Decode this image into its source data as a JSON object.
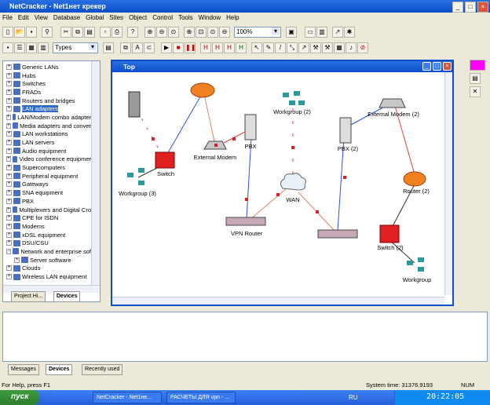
{
  "app": {
    "title": "NetCracker - Net1нет крекер"
  },
  "menu": [
    "File",
    "Edit",
    "View",
    "Database",
    "Global",
    "Sites",
    "Object",
    "Control",
    "Tools",
    "Window",
    "Help"
  ],
  "toolbar": {
    "zoom": "100%",
    "types": "Types"
  },
  "tree": [
    "Generic LANs",
    "Hubs",
    "Switches",
    "FRADs",
    "Routers and bridges",
    "LAN adapters",
    "LAN/Modem combo adapter",
    "Media adapters and conver",
    "LAN workstations",
    "LAN servers",
    "Audio equipment",
    "Video conference equipmer",
    "Supercomputers",
    "Peripheral equipment",
    "Gateways",
    "SNA equipment",
    "PBX",
    "Multiplexers and Digital Cro",
    "CPE for ISDN",
    "Modems",
    "xDSL equipment",
    "DSU/CSU",
    "Network and enterprise sof",
    "Server software",
    "Clouds",
    "Wireless LAN equipment"
  ],
  "tree_selected": "LAN adapters",
  "left_tabs": [
    "Project Hi...",
    "Devices"
  ],
  "canvas": {
    "title": "Top",
    "nodes": {
      "switch": "Switch",
      "workgroup3": "Workgroup (3)",
      "ext_modem": "External Modem",
      "pbx": "PBX",
      "workgroup2": "Workgroup (2)",
      "wan": "WAN",
      "vpn_router": "VPN Router",
      "pbx2": "PBX (2)",
      "ext_modem2": "External Modem (2)",
      "router2": "Router (2)",
      "switch2": "Switch (2)",
      "workgroup": "Workgroup"
    }
  },
  "bottom_tabs": [
    "Messages",
    "Devices",
    "Recently used"
  ],
  "status": {
    "help": "For Help, press F1",
    "system_time": "System time: 31376.9193",
    "num": "NUM"
  },
  "taskbar": {
    "start": "пуск",
    "tasks": [
      "NetCracker - Net1не...",
      "РАСЧЕТЫ ДЛЯ vpn - ..."
    ],
    "lang": "RU",
    "clock": "20:22:05"
  }
}
